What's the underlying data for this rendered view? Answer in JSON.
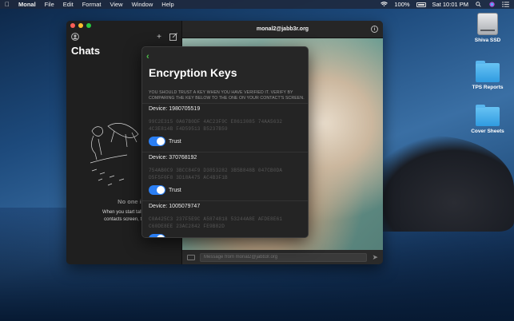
{
  "menubar": {
    "app_name": "Monal",
    "menus": [
      "File",
      "Edit",
      "Format",
      "View",
      "Window",
      "Help"
    ],
    "battery": "100%",
    "clock": "Sat 10:01 PM"
  },
  "desktop": {
    "icons": [
      {
        "label": "Shiva SSD",
        "type": "drive"
      },
      {
        "label": "TPS Reports",
        "type": "folder"
      },
      {
        "label": "Cover Sheets",
        "type": "folder"
      }
    ]
  },
  "sidebar": {
    "title": "Chats",
    "empty_title": "No one is here",
    "empty_line1": "When you start talking to som",
    "empty_line2": "contacts screen, they will sh"
  },
  "chat": {
    "header_title": "monal2@jabb3r.org",
    "input_placeholder": "Message from monal2@jabb3r.org"
  },
  "encryption": {
    "title": "Encryption Keys",
    "note": "You should trust a key when you have verified it. Verify by comparing the key below to the one on your contact's screen.",
    "trust_label": "Trust",
    "devices": [
      {
        "label": "Device: 1980705519",
        "key_line1": "99C2E315 0A67B0DF 4AC23F9C E8613085 74AA5632",
        "key_line2": "4C3E814B F4D59513 B5237B59",
        "trusted": true
      },
      {
        "label": "Device: 370768192",
        "key_line1": "754AB0C9 3BCC84F9 D3853282 3B5B848B 047CB0DA",
        "key_line2": "D5F5F0F8 3D18A475 AC4B3F1B",
        "trusted": true
      },
      {
        "label": "Device: 1005079747",
        "key_line1": "C0A425C3 237F5E9C A5874818 53244A8E AFDE8E61",
        "key_line2": "C60DE8EE 23AC2842 FE9B82D",
        "trusted": true
      }
    ]
  }
}
